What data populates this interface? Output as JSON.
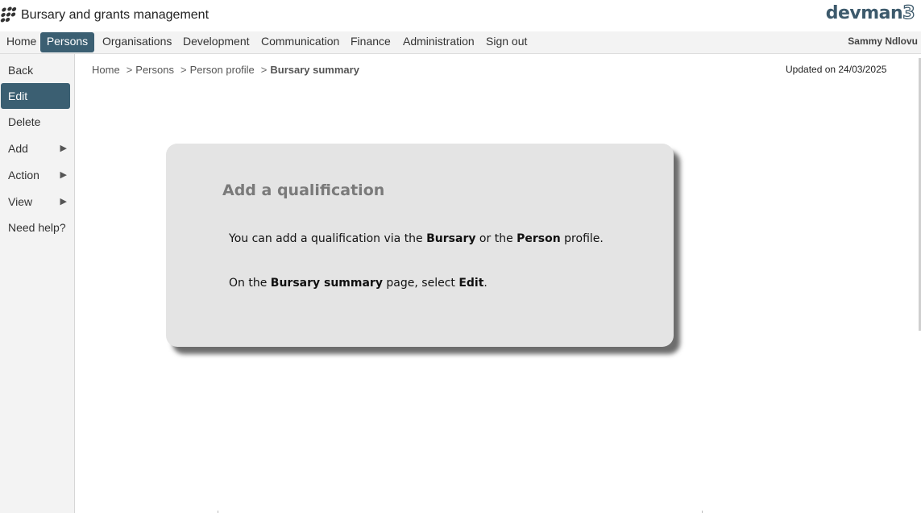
{
  "app": {
    "title": "Bursary and grants management",
    "brand_text": "devman",
    "brand_num": "3",
    "brand_color": "#3d5a6c"
  },
  "topnav": {
    "items": [
      {
        "label": "Home"
      },
      {
        "label": "Persons",
        "active": true
      },
      {
        "label": "Organisations"
      },
      {
        "label": "Development"
      },
      {
        "label": "Communication"
      },
      {
        "label": "Finance"
      },
      {
        "label": "Administration"
      },
      {
        "label": "Sign out"
      }
    ],
    "user": "Sammy Ndlovu",
    "active_color": "#3b5f72"
  },
  "sidebar": {
    "items": [
      {
        "label": "Back"
      },
      {
        "label": "Edit",
        "active": true
      },
      {
        "label": "Delete"
      },
      {
        "label": "Add",
        "arrow": "▶"
      },
      {
        "label": "Action",
        "arrow": "▶"
      },
      {
        "label": "View",
        "arrow": "▶"
      },
      {
        "label": "Need help?"
      }
    ]
  },
  "breadcrumb": {
    "items": [
      "Home",
      "Persons",
      "Person profile",
      "Bursary summary"
    ],
    "separator": ">"
  },
  "updated": "Updated on 24/03/2025",
  "card": {
    "title": "Add a qualification",
    "line1": {
      "t1": "You can add a qualification via the ",
      "b1": "Bursary",
      "t2": " or the ",
      "b2": "Person",
      "t3": " profile."
    },
    "line2": {
      "t1": "On the ",
      "b1": "Bursary summary",
      "t2": " page, select ",
      "b2": "Edit",
      "t3": "."
    }
  }
}
